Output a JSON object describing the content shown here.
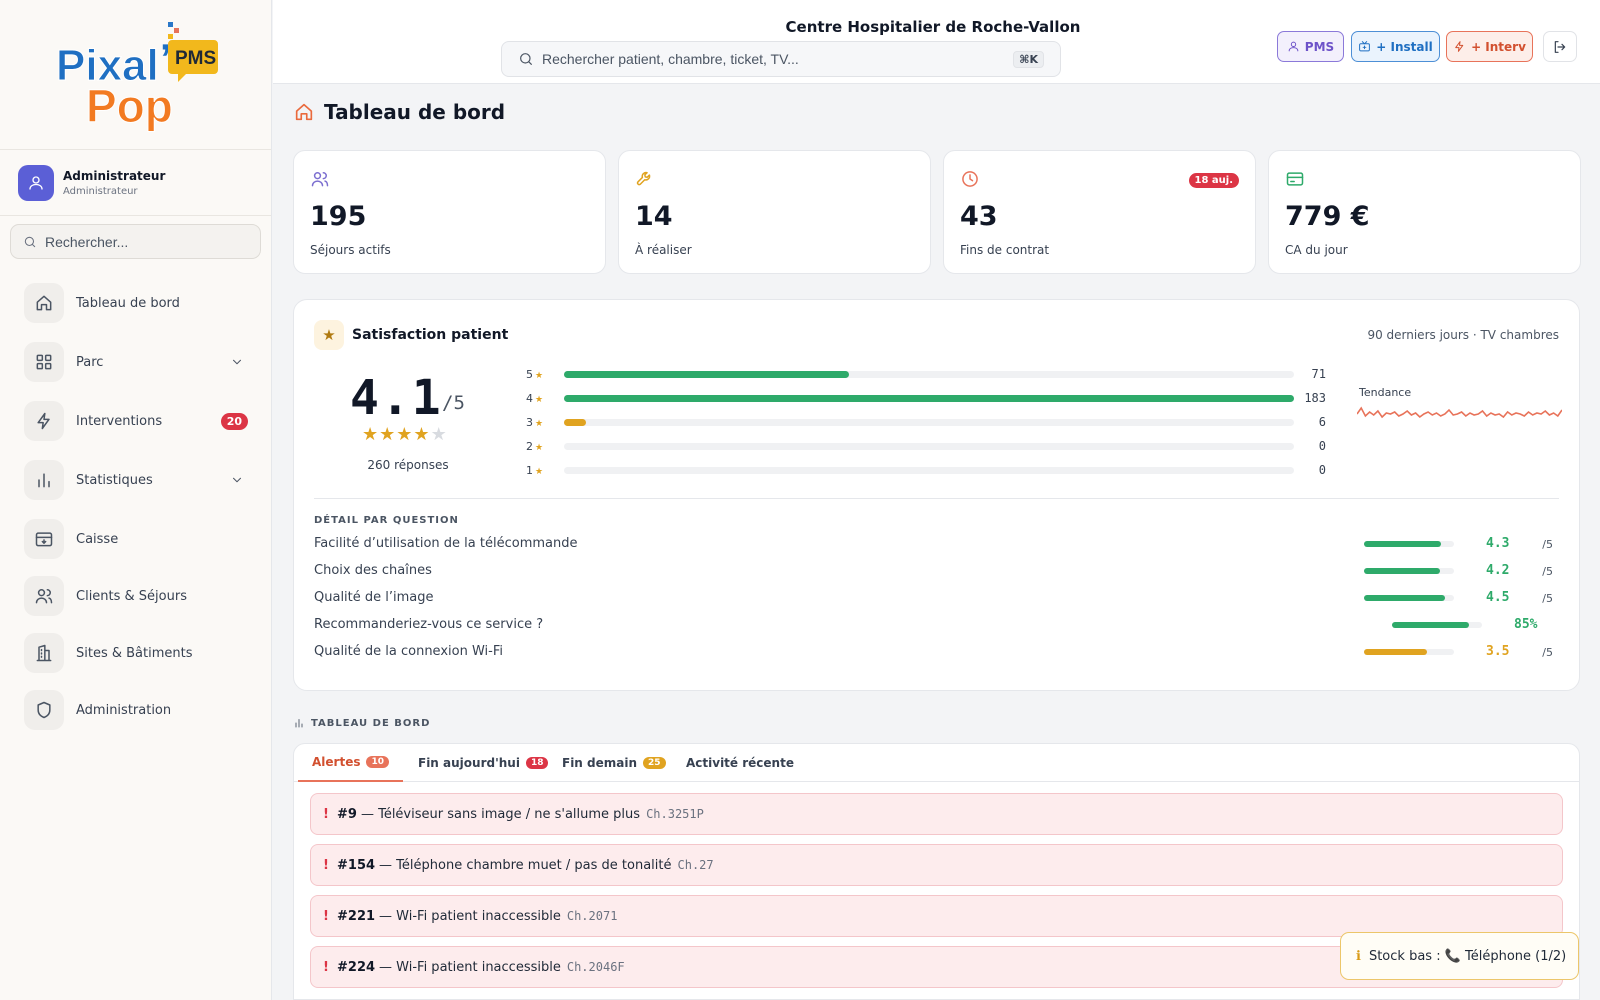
{
  "brand": {
    "logo_top": "Pixal",
    "logo_bottom": "Pop",
    "logo_tag": "PMS"
  },
  "user": {
    "name": "Administrateur",
    "role": "Administrateur"
  },
  "sidebar": {
    "search_placeholder": "Rechercher...",
    "items": [
      {
        "label": "Tableau de bord",
        "icon": "home-icon"
      },
      {
        "label": "Parc",
        "icon": "grid-icon",
        "expandable": true
      },
      {
        "label": "Interventions",
        "icon": "bolt-icon",
        "badge": "20"
      },
      {
        "label": "Statistiques",
        "icon": "bar-chart-icon",
        "expandable": true
      },
      {
        "label": "Caisse",
        "icon": "cash-register-icon"
      },
      {
        "label": "Clients & Séjours",
        "icon": "users-icon"
      },
      {
        "label": "Sites & Bâtiments",
        "icon": "building-icon"
      },
      {
        "label": "Administration",
        "icon": "shield-icon"
      }
    ]
  },
  "header": {
    "hospital": "Centre Hospitalier de Roche-Vallon",
    "search_placeholder": "Rechercher patient, chambre, ticket, TV...",
    "shortcut": "⌘K",
    "buttons": {
      "pms": "PMS",
      "install": "+ Install",
      "interv": "+ Interv"
    }
  },
  "page": {
    "title": "Tableau de bord"
  },
  "kpis": [
    {
      "value": "195",
      "label": "Séjours actifs",
      "icon": "users-icon",
      "color": "#7c6fd0"
    },
    {
      "value": "14",
      "label": "À réaliser",
      "icon": "wrench-icon",
      "color": "#e0a320"
    },
    {
      "value": "43",
      "label": "Fins de contrat",
      "icon": "clock-icon",
      "color": "#e8735a",
      "badge": "18 auj."
    },
    {
      "value": "779 €",
      "label": "CA du jour",
      "icon": "card-icon",
      "color": "#2eaa6a"
    }
  ],
  "satisfaction": {
    "title": "Satisfaction patient",
    "range": "90 derniers jours · TV chambres",
    "score": "4.1",
    "max": "/5",
    "stars_filled": 4,
    "responses": "260 réponses",
    "distribution": [
      {
        "stars": "5",
        "count": "71",
        "fraction": 0.39,
        "color": "#2eaa6a"
      },
      {
        "stars": "4",
        "count": "183",
        "fraction": 1.0,
        "color": "#2eaa6a"
      },
      {
        "stars": "3",
        "count": "6",
        "fraction": 0.03,
        "color": "#e0a320"
      },
      {
        "stars": "2",
        "count": "0",
        "fraction": 0,
        "color": "#2eaa6a"
      },
      {
        "stars": "1",
        "count": "0",
        "fraction": 0,
        "color": "#2eaa6a"
      }
    ],
    "trend_label": "Tendance",
    "trend_color": "#e8735a",
    "detail_title": "DÉTAIL PAR QUESTION",
    "questions": [
      {
        "label": "Facilité d’utilisation de la télécommande",
        "value": "4.3",
        "suffix": "/5",
        "fraction": 0.86,
        "color": "#2eaa6a"
      },
      {
        "label": "Choix des chaînes",
        "value": "4.2",
        "suffix": "/5",
        "fraction": 0.84,
        "color": "#2eaa6a"
      },
      {
        "label": "Qualité de l’image",
        "value": "4.5",
        "suffix": "/5",
        "fraction": 0.9,
        "color": "#2eaa6a"
      },
      {
        "label": "Recommanderiez-vous ce service ?",
        "value": "85%",
        "suffix": "",
        "fraction": 0.85,
        "color": "#2eaa6a"
      },
      {
        "label": "Qualité de la connexion Wi-Fi",
        "value": "3.5",
        "suffix": "/5",
        "fraction": 0.7,
        "color": "#e0a320"
      }
    ]
  },
  "dashboard": {
    "section_title": "TABLEAU DE BORD",
    "tabs": [
      {
        "label": "Alertes",
        "badge": "10",
        "badge_color": "#e8735a",
        "active": true
      },
      {
        "label": "Fin aujourd'hui",
        "badge": "18",
        "badge_color": "#dc3545"
      },
      {
        "label": "Fin demain",
        "badge": "25",
        "badge_color": "#e0a320"
      },
      {
        "label": "Activité récente"
      }
    ],
    "alerts": [
      {
        "id": "#9",
        "text": "— Téléviseur sans image / ne s'allume plus",
        "room": "Ch.3251P"
      },
      {
        "id": "#154",
        "text": "— Téléphone chambre muet / pas de tonalité",
        "room": "Ch.27"
      },
      {
        "id": "#221",
        "text": "— Wi-Fi patient inaccessible",
        "room": "Ch.2071"
      },
      {
        "id": "#224",
        "text": "— Wi-Fi patient inaccessible",
        "room": "Ch.2046F"
      }
    ]
  },
  "toast": {
    "icon": "info-icon",
    "text": "Stock bas : 📞 Téléphone (1/2)"
  }
}
